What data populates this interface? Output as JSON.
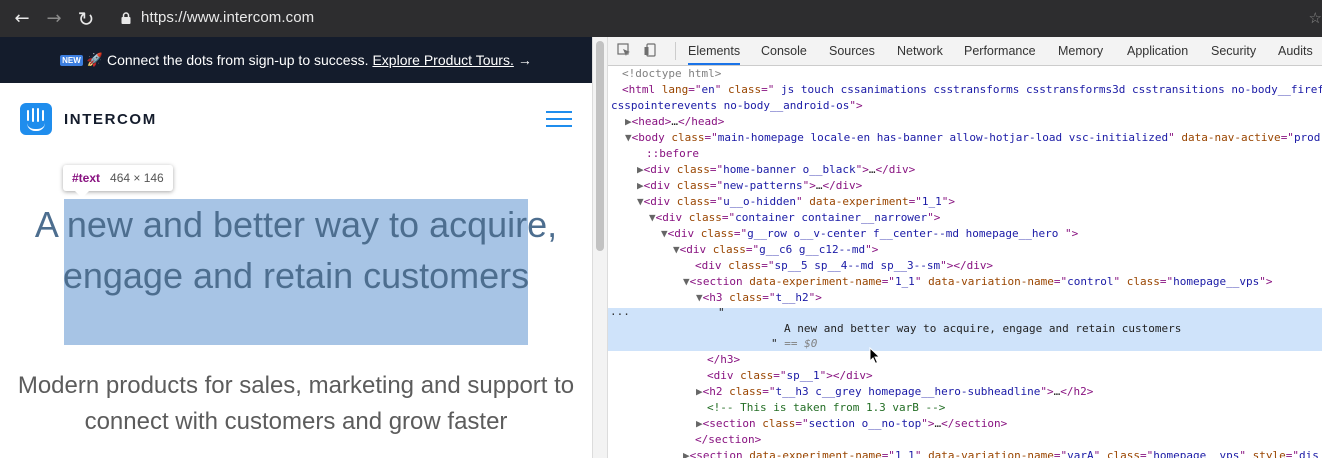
{
  "browser": {
    "url": "https://www.intercom.com",
    "back_icon": "←",
    "forward_icon": "→",
    "reload_icon": "↻",
    "star_icon": "☆"
  },
  "site": {
    "banner": {
      "badge": "NEW",
      "rocket": "🚀",
      "text": "Connect the dots from sign-up to success.",
      "link": "Explore Product Tours.",
      "arrow": "→"
    },
    "logo_text": "INTERCOM",
    "tooltip": {
      "tag": "#text",
      "size": "464 × 146"
    },
    "hero_title": "A new and better way to acquire, engage and retain customers",
    "hero_subtitle": "Modern products for sales, marketing and support to connect with customers and grow faster"
  },
  "devtools": {
    "tabs": [
      "Elements",
      "Console",
      "Sources",
      "Network",
      "Performance",
      "Memory",
      "Application",
      "Security",
      "Audits"
    ],
    "active_tab": "Elements",
    "dom": {
      "doctype": "<!doctype html>",
      "html_lang": "en",
      "html_class_1": " js touch cssanimations csstransforms csstransforms3d csstransitions no-body__firef",
      "html_class_2": "csspointerevents no-body__android-os",
      "body_class": "main-homepage locale-en has-banner allow-hotjar-load vsc-initialized",
      "body_nav_attr": "data-nav-active",
      "body_nav_val": "prod",
      "before": "::before",
      "div1_class": "home-banner o__black",
      "div2_class": "new-patterns",
      "div3_class": "u__o-hidden",
      "div3_exp": "1_1",
      "div4_class": "container container__narrower",
      "div5_class": "g__row o__v-center f__center--md homepage__hero ",
      "div6_class": "g__c6 g__c12--md",
      "div7_class": "sp__5 sp__4--md sp__3--sm",
      "section1_exp": "1_1",
      "section1_var": "control",
      "section1_class": "homepage__vps",
      "h3_class": "t__h2",
      "quote": "\"",
      "text_node": "A new and better way to acquire, engage and retain customers",
      "eq": "== $0",
      "div8_class": "sp__1",
      "h2_class": "t__h3 c__grey homepage__hero-subheadline",
      "comment": "<!-- This is taken from 1.3 varB -->",
      "section2_class": "section o__no-top",
      "section3_exp": "1_1",
      "section3_var": "varA",
      "section3_class": "homepage__vps",
      "section3_style": "dis"
    }
  }
}
